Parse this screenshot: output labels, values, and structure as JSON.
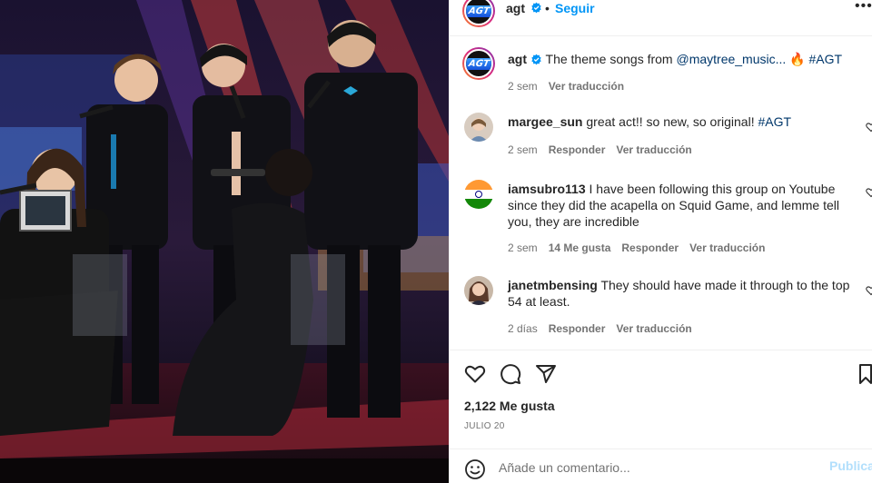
{
  "post": {
    "username": "agt",
    "follow_label": "Seguir",
    "more_label": "•••",
    "verified_icon": "verified-badge-icon",
    "avatar_text": "AGT"
  },
  "caption": {
    "username": "agt",
    "text": "The theme songs from",
    "mention": "@maytree_music...",
    "emoji": "🔥",
    "hashtag": "#AGT",
    "time": "2 sem",
    "translate": "Ver traducción"
  },
  "comments": [
    {
      "username": "margee_sun",
      "text": "great act!! so new, so original!",
      "hashtag": "#AGT",
      "time": "2 sem",
      "likes": "",
      "reply": "Responder",
      "translate": "Ver traducción",
      "avatar": "woman-smiling"
    },
    {
      "username": "iamsubro113",
      "text": "I have been following this group on Youtube since they did the acapella on Squid Game, and lemme tell you, they are incredible",
      "hashtag": "",
      "time": "2 sem",
      "likes": "14 Me gusta",
      "reply": "Responder",
      "translate": "Ver traducción",
      "avatar": "india-flag"
    },
    {
      "username": "janetmbensing",
      "text": "They should have made it through to the top 54 at least.",
      "hashtag": "",
      "time": "2 días",
      "likes": "",
      "reply": "Responder",
      "translate": "Ver traducción",
      "avatar": "woman-portrait"
    }
  ],
  "actions": {
    "likes": "2,122 Me gusta",
    "date": "JULIO 20",
    "comment_placeholder": "Añade un comentario...",
    "publish_label": "Publica"
  },
  "colors": {
    "link_blue": "#0095f6",
    "mention_blue": "#00376b",
    "muted": "#737373",
    "publish_disabled": "#b2dffc"
  }
}
